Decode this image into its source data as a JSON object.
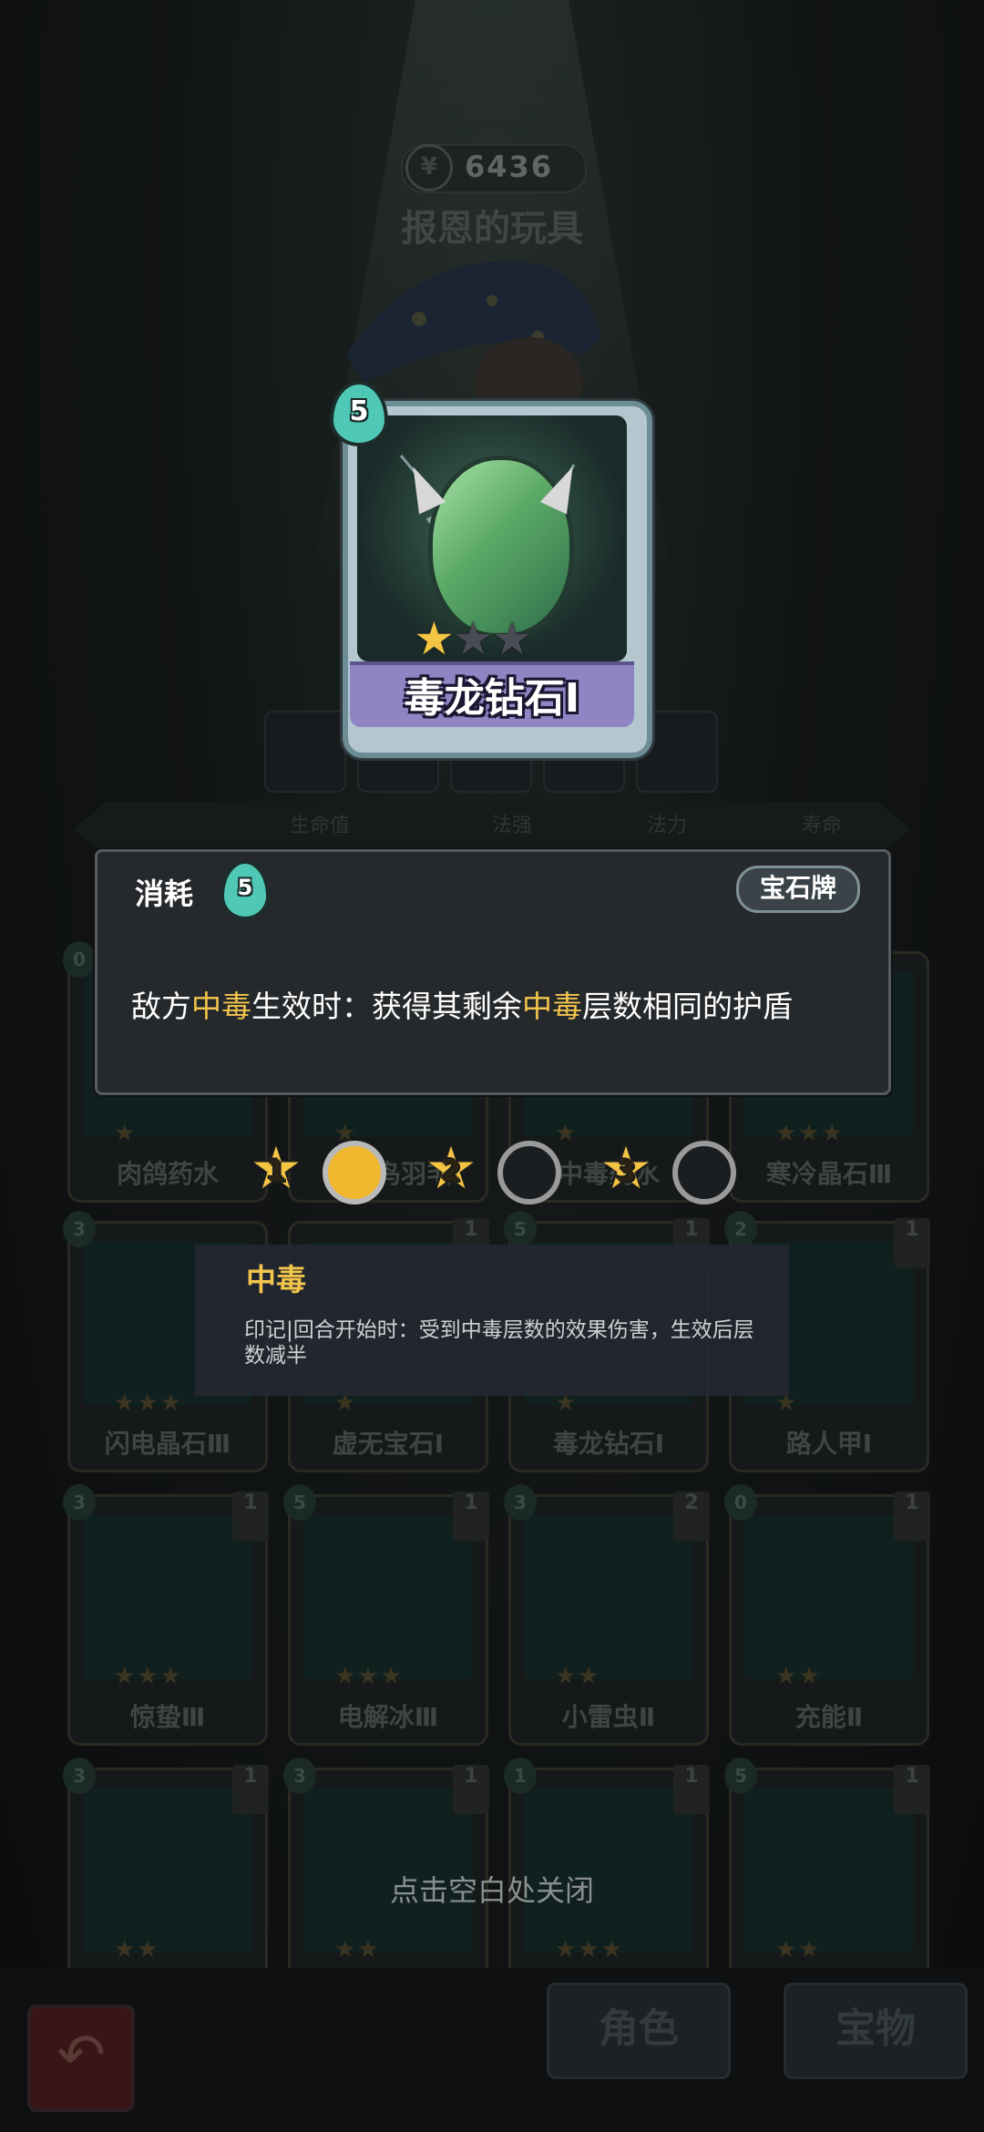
{
  "top": {
    "gold": "6436",
    "character_name": "报恩的玩具"
  },
  "stats": {
    "labels": [
      "生命值",
      "法强",
      "法力",
      "寿命"
    ]
  },
  "featured_card": {
    "cost": "5",
    "name": "毒龙钻石Ⅰ",
    "stars_filled": 1,
    "stars_total": 3
  },
  "info_panel": {
    "cost_label": "消耗",
    "cost_value": "5",
    "tag": "宝石牌",
    "desc_parts": [
      "敌方",
      "中毒",
      "生效时：获得其剩余",
      "中毒",
      "层数相同的护盾"
    ]
  },
  "upgrade_track": {
    "levels": [
      "1",
      "2",
      "3"
    ],
    "active": [
      true,
      false,
      false
    ]
  },
  "tooltip": {
    "title": "中毒",
    "text": "印记|回合开始时：受到中毒层数的效果伤害，生效后层数减半"
  },
  "cards": [
    {
      "name": "肉鸽药水",
      "cost": "0",
      "level": "",
      "stars": "★"
    },
    {
      "name": "迷幻鸟羽毛",
      "cost": "",
      "level": "",
      "stars": "★"
    },
    {
      "name": "中毒药水",
      "cost": "",
      "level": "",
      "stars": "★"
    },
    {
      "name": "寒冷晶石Ⅲ",
      "cost": "",
      "level": "",
      "stars": "★★★"
    },
    {
      "name": "闪电晶石Ⅲ",
      "cost": "3",
      "level": "",
      "stars": "★★★"
    },
    {
      "name": "虚无宝石Ⅰ",
      "cost": "",
      "level": "1",
      "stars": "★"
    },
    {
      "name": "毒龙钻石Ⅰ",
      "cost": "5",
      "level": "1",
      "stars": "★"
    },
    {
      "name": "路人甲Ⅰ",
      "cost": "2",
      "level": "1",
      "stars": "★"
    },
    {
      "name": "惊蛰Ⅲ",
      "cost": "3",
      "level": "1",
      "stars": "★★★"
    },
    {
      "name": "电解冰Ⅲ",
      "cost": "5",
      "level": "1",
      "stars": "★★★"
    },
    {
      "name": "小雷虫Ⅱ",
      "cost": "3",
      "level": "2",
      "stars": "★★"
    },
    {
      "name": "充能Ⅱ",
      "cost": "0",
      "level": "1",
      "stars": "★★"
    },
    {
      "name": "",
      "cost": "3",
      "level": "1",
      "stars": "★★"
    },
    {
      "name": "",
      "cost": "3",
      "level": "1",
      "stars": "★★"
    },
    {
      "name": "",
      "cost": "1",
      "level": "1",
      "stars": "★★★"
    },
    {
      "name": "",
      "cost": "5",
      "level": "1",
      "stars": "★★"
    }
  ],
  "close_hint": "点击空白处关闭",
  "bottom_bar": {
    "tab_role": "角色",
    "tab_treasure": "宝物",
    "back_icon": "back-arrow-icon"
  },
  "colors": {
    "highlight": "#f2c54c",
    "panel_bg": "#26292c",
    "energy": "#4fc8b5",
    "plate": "#8f84c4"
  }
}
